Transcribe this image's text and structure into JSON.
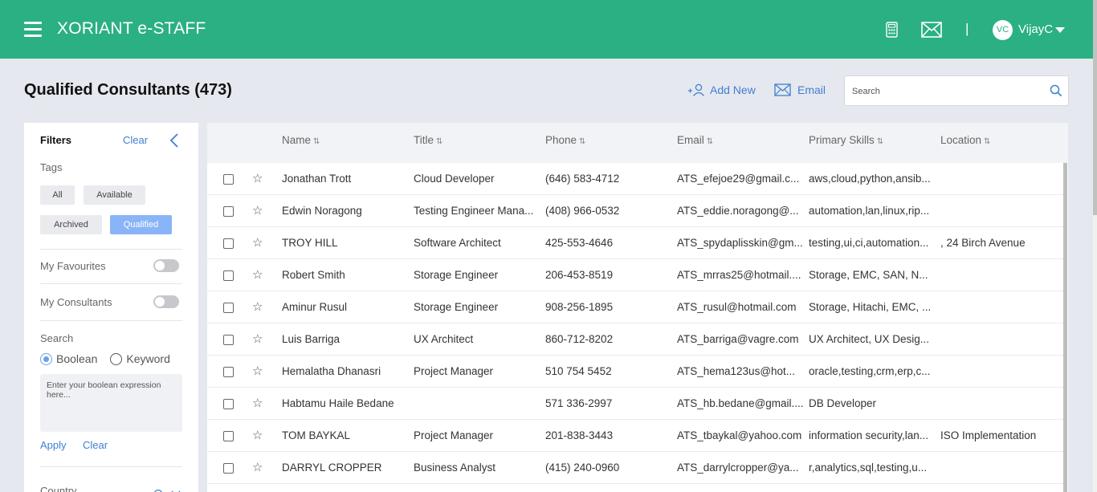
{
  "header": {
    "app_title": "XORIANT e-STAFF",
    "separator": "|",
    "user_initials": "VC",
    "user_name": "VijayC",
    "brand_color": "#2bb083"
  },
  "page": {
    "title": "Qualified Consultants (473)",
    "add_new_label": "Add New",
    "email_label": "Email",
    "search_placeholder": "Search"
  },
  "filters": {
    "title": "Filters",
    "clear_label": "Clear",
    "tags_label": "Tags",
    "tags": [
      {
        "label": "All",
        "active": false
      },
      {
        "label": "Available",
        "active": false
      },
      {
        "label": "Archived",
        "active": false
      },
      {
        "label": "Qualified",
        "active": true
      }
    ],
    "my_favourites_label": "My Favourites",
    "my_favourites_on": false,
    "my_consultants_label": "My Consultants",
    "my_consultants_on": false,
    "search_label": "Search",
    "search_modes": [
      "Boolean",
      "Keyword"
    ],
    "search_mode_selected": "Boolean",
    "boolean_placeholder": "Enter your boolean expression here...",
    "apply_label": "Apply",
    "clear2_label": "Clear",
    "country_label": "Country"
  },
  "table": {
    "columns": [
      "Name",
      "Title",
      "Phone",
      "Email",
      "Primary Skills",
      "Location"
    ],
    "sort_glyph": "⇅",
    "rows": [
      {
        "name": "Jonathan Trott",
        "title": "Cloud Developer",
        "phone": "(646) 583-4712",
        "email": "ATS_efejoe29@gmail.c...",
        "skills": "aws,cloud,python,ansib...",
        "location": ""
      },
      {
        "name": "Edwin Noragong",
        "title": "Testing Engineer Mana...",
        "phone": "(408) 966-0532",
        "email": "ATS_eddie.noragong@...",
        "skills": "automation,lan,linux,rip...",
        "location": ""
      },
      {
        "name": "TROY HILL",
        "title": "Software Architect",
        "phone": "425-553-4646",
        "email": "ATS_spydaplisskin@gm...",
        "skills": "testing,ui,ci,automation...",
        "location": ", 24 Birch Avenue"
      },
      {
        "name": "Robert Smith",
        "title": "Storage Engineer",
        "phone": "206-453-8519",
        "email": "ATS_mrras25@hotmail....",
        "skills": "Storage, EMC, SAN, N...",
        "location": ""
      },
      {
        "name": "Aminur Rusul",
        "title": "Storage Engineer",
        "phone": "908-256-1895",
        "email": "ATS_rusul@hotmail.com",
        "skills": "Storage, Hitachi, EMC, ...",
        "location": ""
      },
      {
        "name": "Luis Barriga",
        "title": "UX Architect",
        "phone": "860-712-8202",
        "email": "ATS_barriga@vagre.com",
        "skills": "UX Architect, UX Desig...",
        "location": ""
      },
      {
        "name": "Hemalatha Dhanasri",
        "title": "Project Manager",
        "phone": "510 754 5452",
        "email": "ATS_hema123us@hot...",
        "skills": "oracle,testing,crm,erp,c...",
        "location": ""
      },
      {
        "name": "Habtamu Haile Bedane",
        "title": "",
        "phone": "571 336-2997",
        "email": "ATS_hb.bedane@gmail....",
        "skills": "DB Developer",
        "location": ""
      },
      {
        "name": "TOM BAYKAL",
        "title": "Project Manager",
        "phone": "201-838-3443",
        "email": "ATS_tbaykal@yahoo.com",
        "skills": "information security,lan...",
        "location": "ISO Implementation"
      },
      {
        "name": "DARRYL CROPPER",
        "title": "Business Analyst",
        "phone": "(415) 240-0960",
        "email": "ATS_darrylcropper@ya...",
        "skills": "r,analytics,sql,testing,u...",
        "location": ""
      }
    ]
  }
}
